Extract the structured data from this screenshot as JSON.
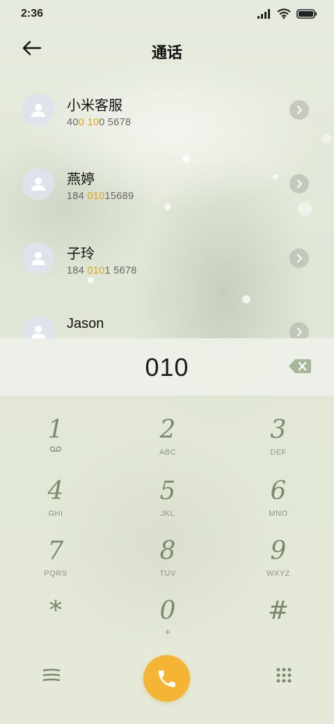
{
  "status": {
    "time": "2:36",
    "icons": [
      "signal-icon",
      "wifi-icon",
      "battery-icon"
    ]
  },
  "header": {
    "title": "通话",
    "back_icon": "back-arrow-icon"
  },
  "contacts": [
    {
      "name": "小米客服",
      "number_parts": [
        [
          "40",
          false
        ],
        [
          "0",
          true
        ],
        [
          " ",
          false
        ],
        [
          "10",
          true
        ],
        [
          "0 5678",
          false
        ]
      ]
    },
    {
      "name": "燕婷",
      "number_parts": [
        [
          "184 ",
          false
        ],
        [
          "010",
          true
        ],
        [
          "15689",
          false
        ]
      ]
    },
    {
      "name": "子玲",
      "number_parts": [
        [
          "184 ",
          false
        ],
        [
          "010",
          true
        ],
        [
          "1 5678",
          false
        ]
      ]
    },
    {
      "name": "Jason",
      "number_parts": []
    }
  ],
  "dialer": {
    "input_value": "010",
    "delete_icon": "backspace-icon"
  },
  "keypad": [
    {
      "digit": "1",
      "letters": "",
      "icon": "voicemail-icon"
    },
    {
      "digit": "2",
      "letters": "ABC"
    },
    {
      "digit": "3",
      "letters": "DEF"
    },
    {
      "digit": "4",
      "letters": "GHI"
    },
    {
      "digit": "5",
      "letters": "JKL"
    },
    {
      "digit": "6",
      "letters": "MNO"
    },
    {
      "digit": "7",
      "letters": "PQRS"
    },
    {
      "digit": "8",
      "letters": "TUV"
    },
    {
      "digit": "9",
      "letters": "WXYZ"
    },
    {
      "digit": "*",
      "letters": ""
    },
    {
      "digit": "0",
      "letters": "+"
    },
    {
      "digit": "#",
      "letters": ""
    }
  ],
  "bottom": {
    "menu_icon": "menu-icon",
    "call_icon": "phone-icon",
    "grid_icon": "dialpad-grid-icon"
  },
  "colors": {
    "accent": "#f5b433",
    "highlight": "#e2a417",
    "key_text": "#7a8a6e"
  }
}
